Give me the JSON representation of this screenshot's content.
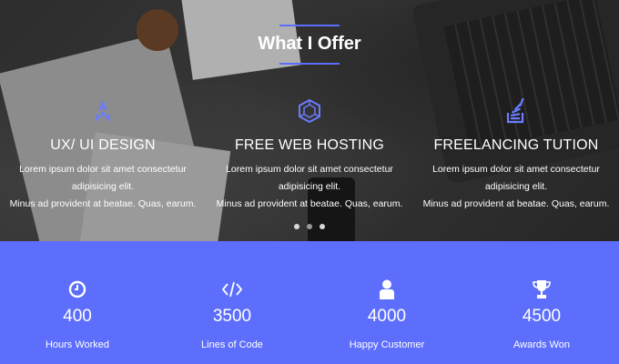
{
  "section": {
    "title": "What I Offer",
    "accent_color": "#5c6dfa"
  },
  "services": [
    {
      "icon": "ux-design-icon",
      "title": "UX/ UI DESIGN",
      "text_line1": "Lorem ipsum dolor sit amet consectetur adipisicing elit.",
      "text_line2": "Minus ad provident at beatae. Quas, earum."
    },
    {
      "icon": "web-hosting-icon",
      "title": "FREE WEB HOSTING",
      "text_line1": "Lorem ipsum dolor sit amet consectetur adipisicing elit.",
      "text_line2": "Minus ad provident at beatae. Quas, earum."
    },
    {
      "icon": "stack-overflow-icon",
      "title": "FREELANCING TUTION",
      "text_line1": "Lorem ipsum dolor sit amet consectetur adipisicing elit.",
      "text_line2": "Minus ad provident at beatae. Quas, earum."
    }
  ],
  "carousel": {
    "slides": 3,
    "active_index": 1
  },
  "stats": {
    "background_color": "#5c6efb",
    "items": [
      {
        "icon": "clock-icon",
        "value": "400",
        "label": "Hours Worked"
      },
      {
        "icon": "code-icon",
        "value": "3500",
        "label": "Lines of Code"
      },
      {
        "icon": "user-icon",
        "value": "4000",
        "label": "Happy Customer"
      },
      {
        "icon": "trophy-icon",
        "value": "4500",
        "label": "Awards Won"
      }
    ]
  }
}
